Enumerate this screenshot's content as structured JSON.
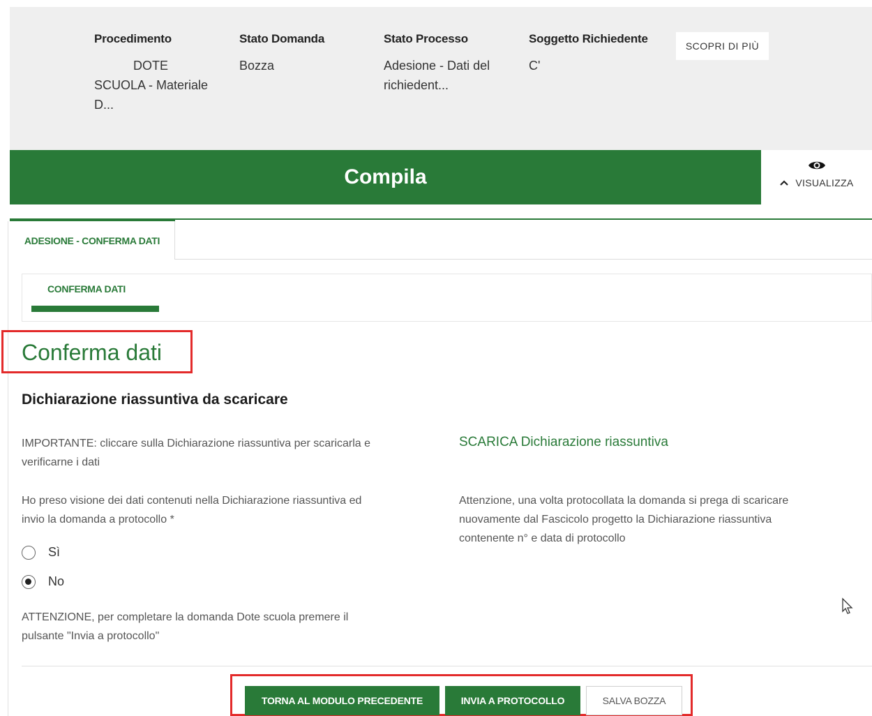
{
  "header": {
    "columns": [
      {
        "label": "Procedimento",
        "value_line1": "DOTE",
        "value_line2": "SCUOLA - Materiale",
        "value_line3": "D..."
      },
      {
        "label": "Stato Domanda",
        "value": "Bozza"
      },
      {
        "label": "Stato Processo",
        "value_line1": "Adesione - Dati del",
        "value_line2": "richiedent..."
      },
      {
        "label": "Soggetto Richiedente",
        "value": "C'"
      }
    ],
    "scopri_label": "SCOPRI DI PIÙ"
  },
  "compila": {
    "title": "Compila",
    "visualizza_label": "VISUALIZZA",
    "eye_icon": "eye-icon",
    "chevron_icon": "chevron-up-icon"
  },
  "tabs": {
    "main": "ADESIONE - CONFERMA DATI",
    "sub": "CONFERMA DATI"
  },
  "section": {
    "title": "Conferma dati",
    "subtitle": "Dichiarazione riassuntiva da scaricare",
    "important_line1": "IMPORTANTE: cliccare sulla Dichiarazione riassuntiva per scaricarla e",
    "important_line2": "verificarne i dati",
    "download_link": "SCARICA Dichiarazione riassuntiva",
    "question_line1": "Ho preso visione dei dati contenuti nella Dichiarazione riassuntiva ed",
    "question_line2": "invio la domanda a protocollo *",
    "attention_right_line1": "Attenzione, una volta protocollata la domanda si prega di scaricare",
    "attention_right_line2": "nuovamente dal Fascicolo progetto la Dichiarazione riassuntiva",
    "attention_right_line3": "contenente n° e data di protocollo",
    "options": [
      "Sì",
      "No"
    ],
    "selected_option": "No",
    "attention_bottom_line1": "ATTENZIONE, per completare la domanda Dote scuola premere il",
    "attention_bottom_line2": "pulsante \"Invia a protocollo\""
  },
  "actions": {
    "back": "TORNA AL MODULO PRECEDENTE",
    "send": "INVIA A PROTOCOLLO",
    "save": "SALVA BOZZA"
  },
  "colors": {
    "green": "#297a38",
    "highlight": "#e32a2a",
    "band": "#efefef"
  }
}
